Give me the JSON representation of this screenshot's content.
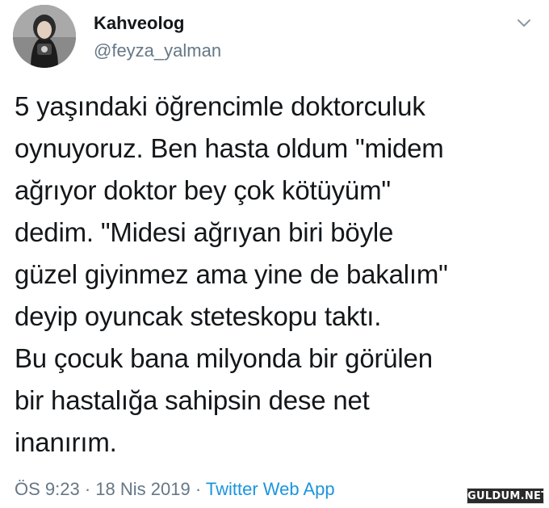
{
  "user": {
    "display_name": "Kahveolog",
    "handle": "@feyza_yalman"
  },
  "tweet": {
    "text": "5 yaşındaki öğrencimle doktorculuk\noynuyoruz. Ben hasta oldum \"midem\nağrıyor doktor bey çok kötüyüm\"\ndedim. \"Midesi ağrıyan biri böyle\ngüzel giyinmez ama yine de bakalım\"\ndeyip oyuncak steteskopu taktı.\nBu çocuk bana milyonda bir görülen\nbir hastalığa sahipsin dese net\ninanırım."
  },
  "meta": {
    "time": "ÖS 9:23",
    "date": "18 Nis 2019",
    "source": "Twitter Web App",
    "separator": " · "
  },
  "watermark": "GULDUM.NET",
  "icons": {
    "caret": "chevron-down-icon"
  },
  "colors": {
    "text": "#14171a",
    "secondary": "#657786",
    "link": "#1b95e0"
  }
}
